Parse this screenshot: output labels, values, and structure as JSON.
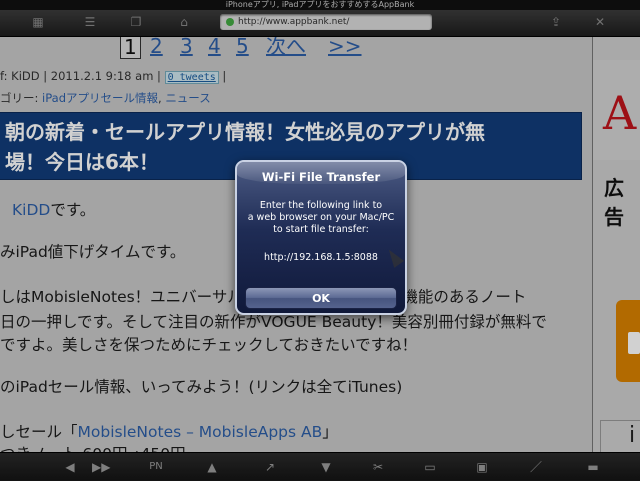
{
  "titlebar": {
    "title": "iPhoneアプリ, iPadアプリをおすすめするAppBank"
  },
  "toolbar": {
    "url": "http://www.appbank.net/",
    "icons": [
      "grid-icon",
      "list-icon",
      "copy-icon",
      "home-icon",
      "share-icon",
      "close-icon"
    ]
  },
  "pager": {
    "items": [
      "1",
      "2",
      "3",
      "4",
      "5",
      "次へ",
      ">>"
    ]
  },
  "post": {
    "meta_prefix": "f: KiDD | 2011.2.1 9:18 am |",
    "tweets": "0 tweets",
    "meta_suffix": "|",
    "category_prefix": "ゴリー:",
    "category1": "iPadアプリセール情報",
    "category_sep": ",",
    "category2": "ニュース",
    "headline_line1": "朝の新着・セールアプリ情報！女性必見のアプリが無",
    "headline_line2": "場！今日は6本！",
    "line1_link": "KiDD",
    "line1_suffix": "です。",
    "line2": "みiPad値下げタイムです。",
    "line3": "しはMobisleNotes！ユニバーサルアプリでPCとのテスト機能のあるノート",
    "line4": "日の一押しです。そして注目の新作がVOGUE Beauty！美容別冊付録が無料で",
    "line5": "ですよ。美しさを保つためにチェックしておきたいですね！",
    "line6": "のiPadセール情報、いってみよう！(リンクは全てiTunes)",
    "line7_prefix": "しセール「",
    "line7_link": "MobisleNotes – MobisleApps AB",
    "line7_suffix": "」",
    "line8": "つきノート 600円→450円"
  },
  "ads": {
    "ad1_letter": "A",
    "ad1_text": "広告",
    "ad3_text": "i"
  },
  "bottombar": {
    "pn_label": "PN",
    "icons": [
      "back-icon",
      "forward-icon",
      "pn-icon",
      "up-arrow-icon",
      "trend-icon",
      "down-arrow-icon",
      "scissors-icon",
      "folder-icon",
      "clipboard-icon",
      "pen-icon",
      "minus-icon"
    ]
  },
  "alert": {
    "title": "Wi-Fi File Transfer",
    "message_line1": "Enter the following link to",
    "message_line2": "a web browser on your Mac/PC",
    "message_line3": "to start file transfer:",
    "url": "http://192.168.1.5:8088",
    "ok_label": "OK"
  }
}
